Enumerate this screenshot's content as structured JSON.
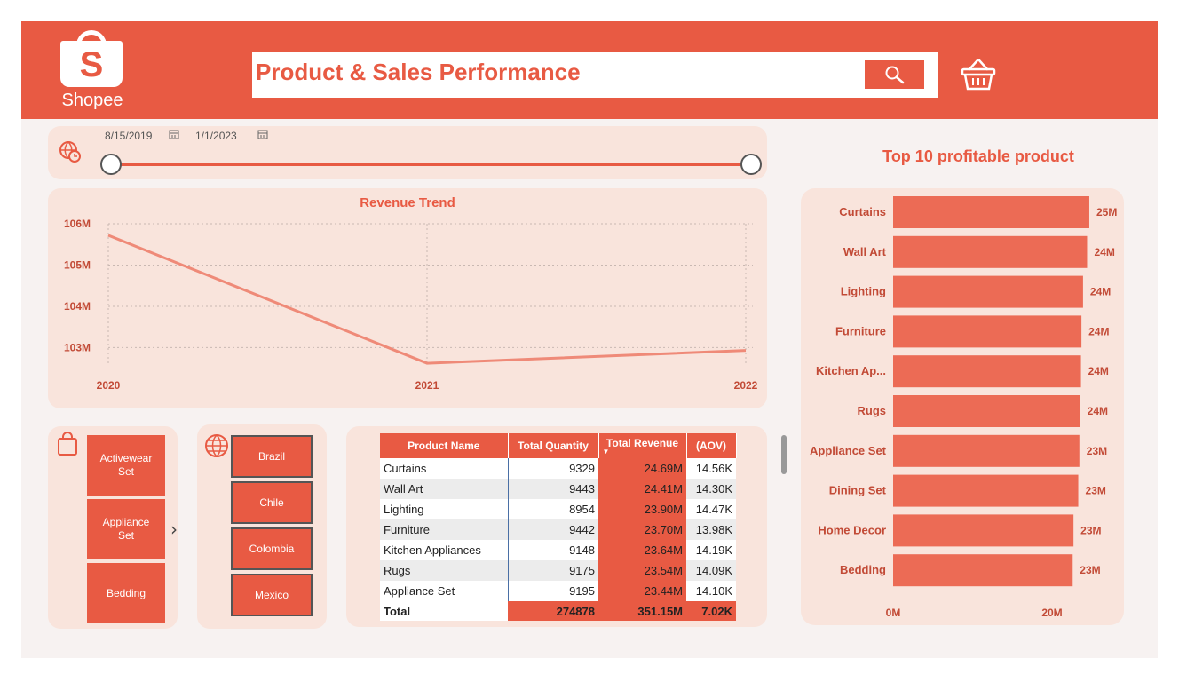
{
  "header": {
    "brand": "Shopee",
    "title": "Product & Sales Performance",
    "search_icon": "search-icon",
    "basket_icon": "basket-icon"
  },
  "date_filter": {
    "start": "8/15/2019",
    "end": "1/1/2023"
  },
  "revenue_trend": {
    "title": "Revenue Trend",
    "y_ticks": [
      "106M",
      "105M",
      "104M",
      "103M"
    ],
    "x_ticks": [
      "2020",
      "2021",
      "2022"
    ]
  },
  "categories": [
    "Activewear Set",
    "Appliance Set",
    "Bedding"
  ],
  "countries": [
    "Brazil",
    "Chile",
    "Colombia",
    "Mexico"
  ],
  "product_table": {
    "columns": [
      "Product Name",
      "Total Quantity",
      "Total Revenue",
      "(AOV)"
    ],
    "rows": [
      [
        "Curtains",
        "9329",
        "24.69M",
        "14.56K"
      ],
      [
        "Wall Art",
        "9443",
        "24.41M",
        "14.30K"
      ],
      [
        "Lighting",
        "8954",
        "23.90M",
        "14.47K"
      ],
      [
        "Furniture",
        "9442",
        "23.70M",
        "13.98K"
      ],
      [
        "Kitchen Appliances",
        "9148",
        "23.64M",
        "14.19K"
      ],
      [
        "Rugs",
        "9175",
        "23.54M",
        "14.09K"
      ],
      [
        "Appliance Set",
        "9195",
        "23.44M",
        "14.10K"
      ]
    ],
    "total": [
      "Total",
      "274878",
      "351.15M",
      "7.02K"
    ]
  },
  "top10": {
    "title": "Top 10 profitable product",
    "x_ticks": [
      "0M",
      "20M"
    ]
  },
  "colors": {
    "accent": "#e85a43",
    "panel": "#f9e4dc",
    "line": "#ef8a78",
    "bar": "#ec6b55"
  },
  "chart_data": [
    {
      "type": "line",
      "title": "Revenue Trend",
      "x": [
        "2020",
        "2021",
        "2022"
      ],
      "series": [
        {
          "values": [
            105.72,
            102.62,
            102.93
          ]
        }
      ],
      "ylim": [
        102.6,
        106.0
      ],
      "grid": true
    },
    {
      "type": "bar",
      "orientation": "horizontal",
      "title": "Top 10 profitable product",
      "categories": [
        "Curtains",
        "Wall Art",
        "Lighting",
        "Furniture",
        "Kitchen Ap...",
        "Rugs",
        "Appliance Set",
        "Dining Set",
        "Home Decor",
        "Bedding"
      ],
      "values": [
        24.69,
        24.41,
        23.9,
        23.7,
        23.64,
        23.54,
        23.44,
        23.3,
        22.7,
        22.6
      ],
      "labels": [
        "25M",
        "24M",
        "24M",
        "24M",
        "24M",
        "24M",
        "23M",
        "23M",
        "23M",
        "23M"
      ],
      "xlim": [
        0,
        20
      ]
    }
  ]
}
